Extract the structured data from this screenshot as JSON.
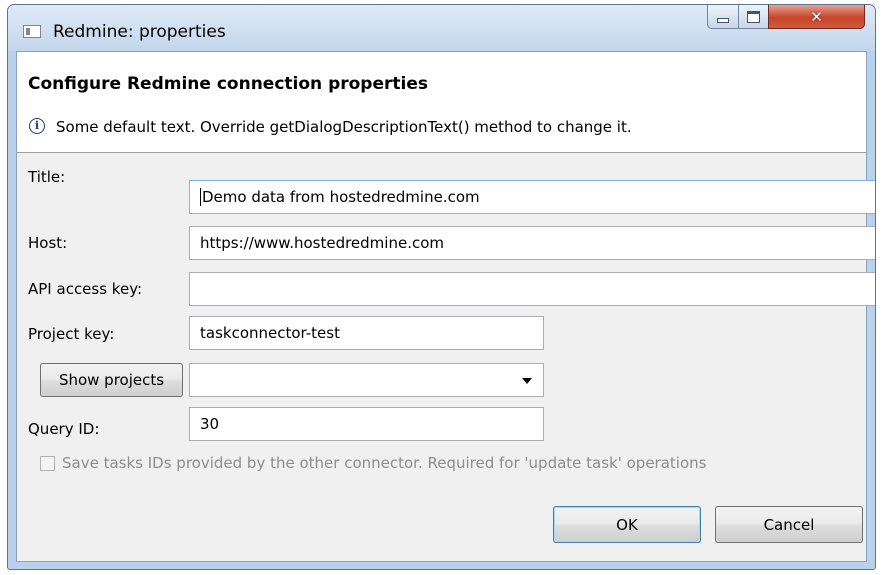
{
  "window": {
    "title": "Redmine: properties"
  },
  "header": {
    "title": "Configure Redmine connection properties",
    "description": "Some default text. Override getDialogDescriptionText() method to change it."
  },
  "form": {
    "title_label": "Title:",
    "title_value": "Demo data from hostedredmine.com",
    "host_label": "Host:",
    "host_value": "https://www.hostedredmine.com",
    "api_key_label": "API access key:",
    "api_key_value": "",
    "project_key_label": "Project key:",
    "project_key_value": "taskconnector-test",
    "show_projects_label": "Show projects",
    "projects_selected": "",
    "query_id_label": "Query ID:",
    "query_id_value": "30",
    "save_ids_label": "Save tasks IDs provided by the other connector. Required for 'update task' operations",
    "save_ids_checked": false
  },
  "buttons": {
    "ok": "OK",
    "cancel": "Cancel"
  },
  "icons": {
    "app": "window-icon",
    "info": "info-icon",
    "minimize": "minimize-icon",
    "maximize": "maximize-icon",
    "close": "close-icon",
    "dropdown": "chevron-down-icon"
  },
  "colors": {
    "titlebar": "#c3d6ec",
    "close_button": "#c7442b",
    "client_bg": "#f0f0f0",
    "disabled_text": "#8d8d8d",
    "focus_border": "#7eb4ea"
  }
}
